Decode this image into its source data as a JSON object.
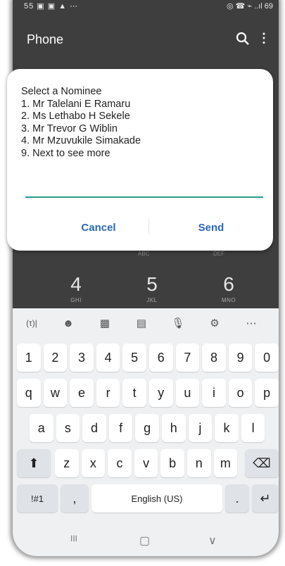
{
  "statusbar": {
    "left": "55 ▣ ▣ ▲ ⋯",
    "right": "◎ ☎ ⌁ ..ıl 69"
  },
  "appbar": {
    "title": "Phone",
    "search_icon": "search-icon",
    "more_icon": "more-vert-icon"
  },
  "dialog": {
    "lines": [
      "Select a Nominee",
      "1. Mr Talelani E Ramaru",
      "2. Ms Lethabo H Sekele",
      "3. Mr Trevor G Wiblin",
      "4. Mr Mzuvukile Simakade",
      "9. Next to see more"
    ],
    "input_value": "",
    "cancel_label": "Cancel",
    "send_label": "Send"
  },
  "dialpad": {
    "faded": [
      "ABC",
      "DEF"
    ],
    "keys": [
      {
        "num": "4",
        "sub": "GHI"
      },
      {
        "num": "5",
        "sub": "JKL"
      },
      {
        "num": "6",
        "sub": "MNO"
      }
    ]
  },
  "keyboard": {
    "toolbar": [
      "(τ)|",
      "☻",
      "▩",
      "▤",
      "🎙",
      "⚙",
      "⋯"
    ],
    "row_numbers": [
      "1",
      "2",
      "3",
      "4",
      "5",
      "6",
      "7",
      "8",
      "9",
      "0"
    ],
    "row_top": [
      "q",
      "w",
      "e",
      "r",
      "t",
      "y",
      "u",
      "i",
      "o",
      "p"
    ],
    "row_mid": [
      "a",
      "s",
      "d",
      "f",
      "g",
      "h",
      "j",
      "k",
      "l"
    ],
    "row_bottom": [
      "z",
      "x",
      "c",
      "v",
      "b",
      "n",
      "m"
    ],
    "shift_label": "⬆",
    "backspace_label": "⌫",
    "symbols_label": "!#1",
    "comma_label": ",",
    "space_label": "English (US)",
    "period_label": ".",
    "enter_label": "↵"
  },
  "navbar": {
    "recent": "III",
    "home": "▢",
    "back": "∨"
  },
  "colors": {
    "accent": "#2a67b4",
    "input_underline": "#2e9b8c",
    "background": "#3e3e3e"
  }
}
